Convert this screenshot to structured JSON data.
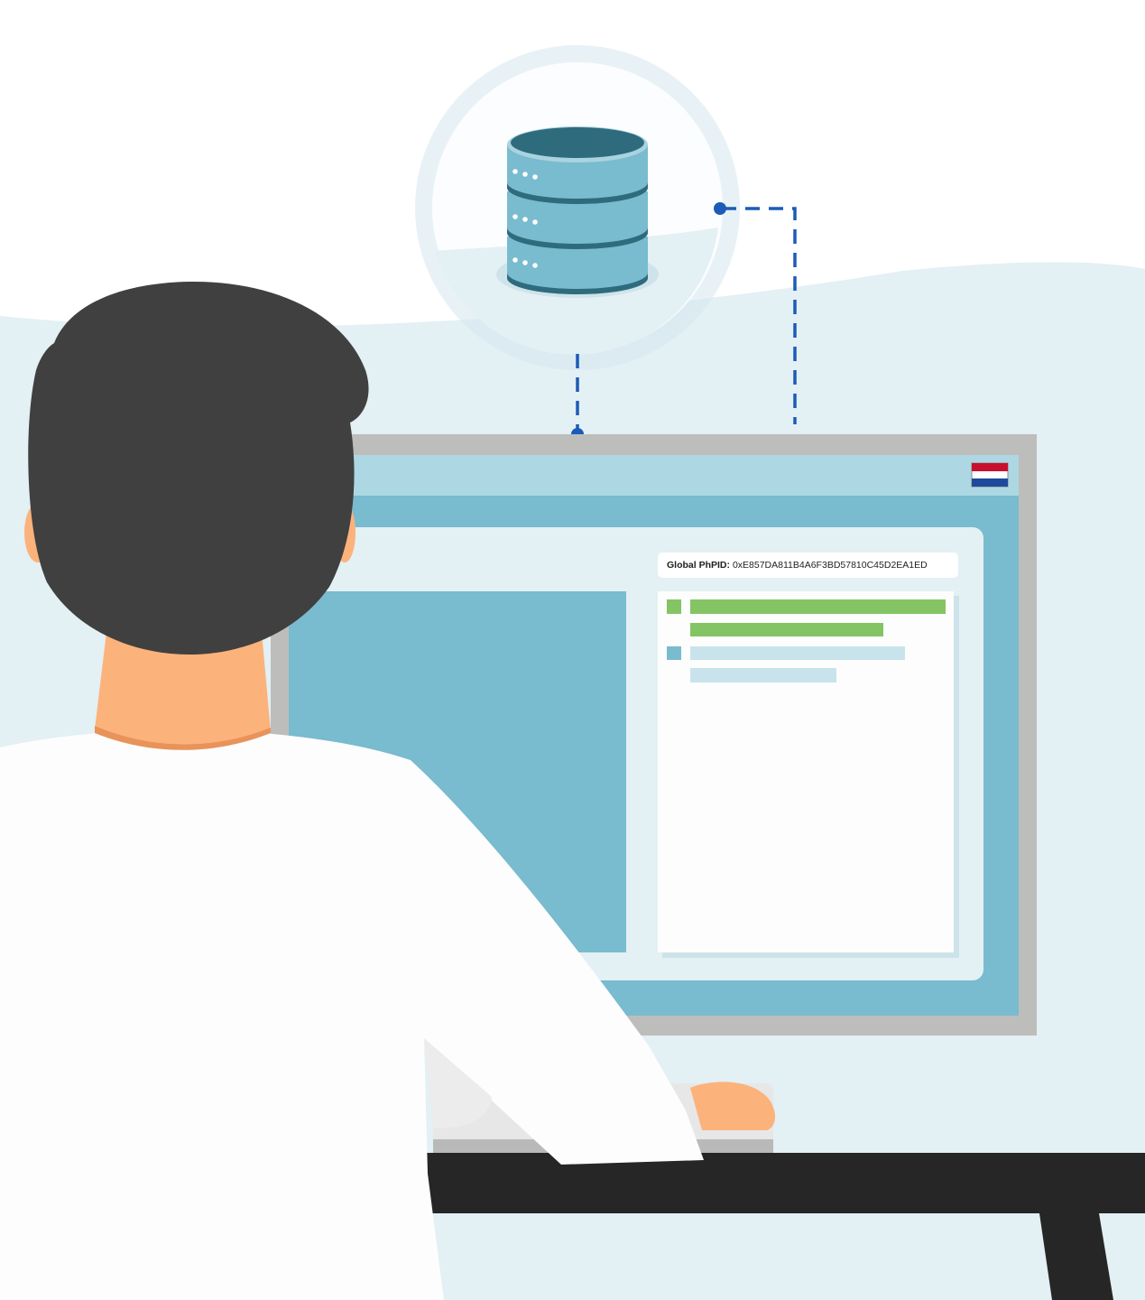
{
  "record": {
    "id_label": "Global PhPID:",
    "id_value": "0xE857DA811B4A6F3BD57810C45D2EA1ED"
  },
  "flag": {
    "country": "Netherlands",
    "colors": [
      "#c8102e",
      "#ffffff",
      "#1f4a9c"
    ]
  },
  "icons": {
    "database": "database-icon",
    "connector": "dashed-connector"
  },
  "colors": {
    "background": "#e3f0f4",
    "screen": "#79bbcf",
    "bar_green": "#84c464",
    "bar_light": "#c9e3ec",
    "connector": "#1c5bb8"
  }
}
